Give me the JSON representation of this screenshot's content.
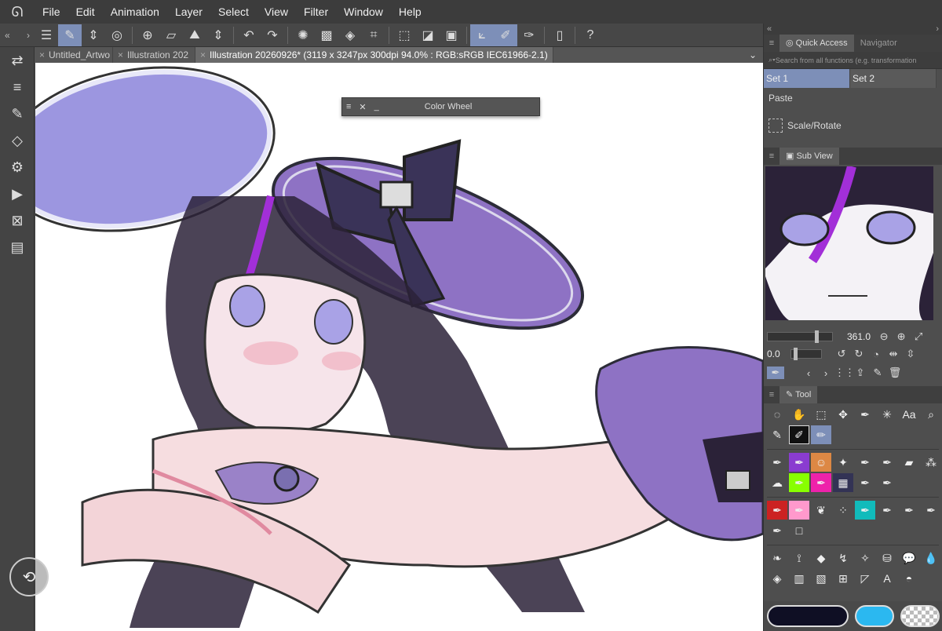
{
  "menu": [
    "File",
    "Edit",
    "Animation",
    "Layer",
    "Select",
    "View",
    "Filter",
    "Window",
    "Help"
  ],
  "toolbar": {
    "collapse_left": "«",
    "collapse_right": "›"
  },
  "tabs": [
    {
      "label": "Untitled_Artwo",
      "active": false
    },
    {
      "label": "Illustration 202",
      "active": false
    },
    {
      "label": "Illustration 20260926* (3119 x 3247px 300dpi 94.0% : RGB:sRGB IEC61966-2.1)",
      "active": true
    }
  ],
  "tab_dropdown": "⌄",
  "color_wheel": {
    "title": "Color Wheel"
  },
  "right_panel": {
    "collapse_left": "«",
    "collapse_right": "›",
    "quick_access_tab": "Quick Access",
    "navigator_tab": "Navigator",
    "search_placeholder": "Search from all functions (e.g. transformation",
    "set1": "Set 1",
    "set2": "Set 2",
    "items": [
      "Paste",
      "Scale/Rotate"
    ],
    "subview_tab": "Sub View",
    "zoom_value": "361.0",
    "rotation_value": "0.0",
    "tool_tab": "Tool"
  },
  "colors": {
    "main": "#0f0f24",
    "sub": "#2bb8f0",
    "accent": "#7d8fb8"
  }
}
